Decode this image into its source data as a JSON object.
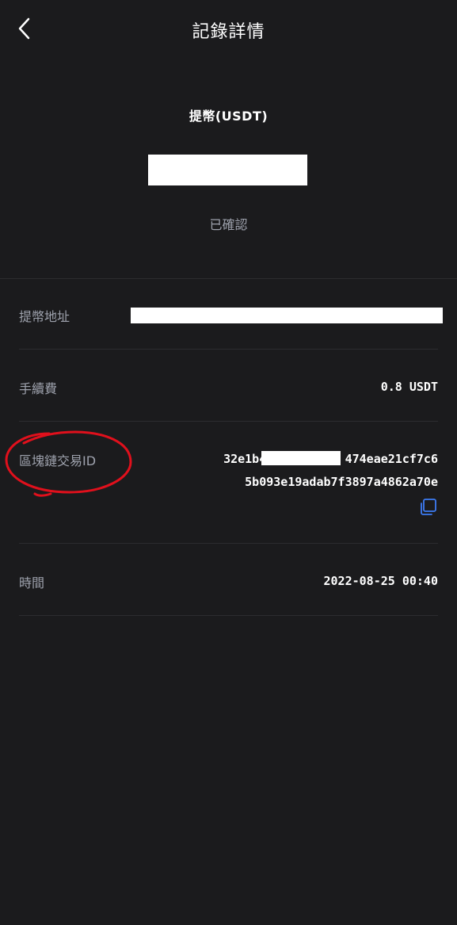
{
  "header": {
    "title": "記錄詳情",
    "back_icon": "chevron-left-icon"
  },
  "summary": {
    "type": "提幣(USDT)",
    "amount": "",
    "status": "已確認"
  },
  "details": {
    "address": {
      "label": "提幣地址",
      "value": ""
    },
    "fee": {
      "label": "手續費",
      "value": "0.8 USDT"
    },
    "txid": {
      "label": "區塊鏈交易ID",
      "line1": "32e1b439f20c83d9          474eae21cf7c6",
      "line2": "5b093e19adab7f3897a4862a70e",
      "copy_icon": "copy-icon"
    },
    "time": {
      "label": "時間",
      "value": "2022-08-25 00:40"
    }
  },
  "colors": {
    "background": "#1b1b1d",
    "label": "#9ea2ad",
    "accent": "#3d7cf5",
    "annotation": "#e0101c"
  }
}
